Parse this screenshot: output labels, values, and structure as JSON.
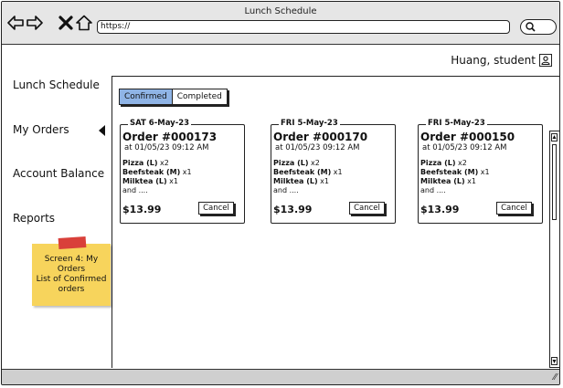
{
  "window": {
    "title": "Lunch Schedule",
    "url": "https://"
  },
  "user": {
    "name": "Huang, student",
    "icon": "user-icon"
  },
  "sidebar": {
    "items": [
      {
        "label": "Lunch Schedule"
      },
      {
        "label": "My Orders"
      },
      {
        "label": "Account Balance"
      },
      {
        "label": "Reports"
      }
    ],
    "active_icon": "triangle-left-icon"
  },
  "sticky_note": {
    "line1": "Screen 4: My",
    "line2": "Orders",
    "line3": "List of Confirmed",
    "line4": "orders"
  },
  "tabs": {
    "confirmed": "Confirmed",
    "completed": "Completed",
    "active_color": "#8fb4e6"
  },
  "orders": [
    {
      "date": "SAT 6-May-23",
      "number": "Order #000173",
      "time": "at 01/05/23 09:12 AM",
      "item1_name": "Pizza (L)",
      "item1_qty": " x2",
      "item2_name": "Beefsteak (M)",
      "item2_qty": " x1",
      "item3_name": "Milktea (L)",
      "item3_qty": " x1",
      "more": "and ....",
      "total": "$13.99",
      "cancel": "Cancel"
    },
    {
      "date": "FRI 5-May-23",
      "number": "Order #000170",
      "time": "at 01/05/23 09:12 AM",
      "item1_name": "Pizza (L)",
      "item1_qty": " x2",
      "item2_name": "Beefsteak (M)",
      "item2_qty": " x1",
      "item3_name": "Milktea (L)",
      "item3_qty": " x1",
      "more": "and ....",
      "total": "$13.99",
      "cancel": "Cancel"
    },
    {
      "date": "FRI 5-May-23",
      "number": "Order #000150",
      "time": "at 01/05/23 09:12 AM",
      "item1_name": "Pizza (L)",
      "item1_qty": " x2",
      "item2_name": "Beefsteak (M)",
      "item2_qty": " x1",
      "item3_name": "Milktea (L)",
      "item3_qty": " x1",
      "more": "and ....",
      "total": "$13.99",
      "cancel": "Cancel"
    }
  ]
}
